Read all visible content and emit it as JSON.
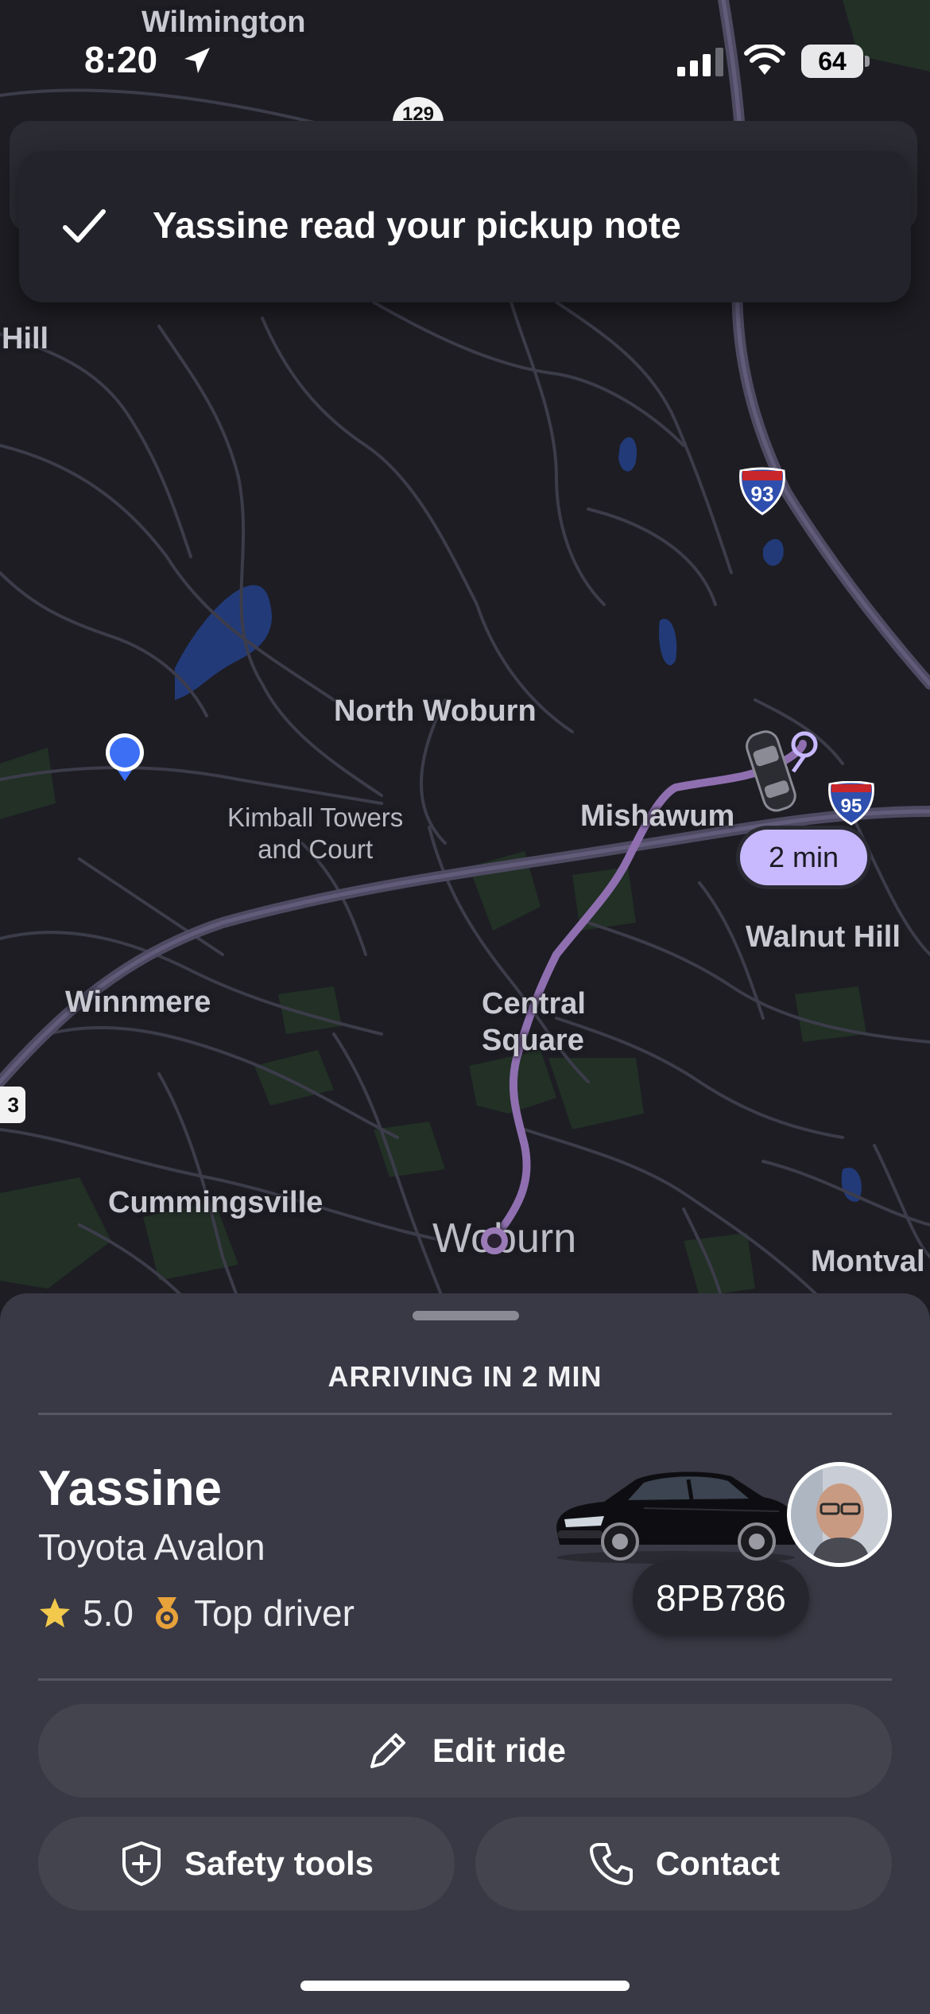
{
  "status_bar": {
    "time": "8:20",
    "battery": "64"
  },
  "toast": {
    "message": "Yassine read your pickup note",
    "icon": "checkmark-icon"
  },
  "map": {
    "labels": {
      "wilmington": "Wilmington",
      "hill": "Hill",
      "north_woburn": "North Woburn",
      "kimball_line1": "Kimball Towers",
      "kimball_line2": "and Court",
      "mishawum": "Mishawum",
      "walnut_hill": "Walnut Hill",
      "winnmere": "Winnmere",
      "central_line1": "Central",
      "central_line2": "Square",
      "cummingsville": "Cummingsville",
      "woburn": "Woburn",
      "montvale": "Montval"
    },
    "shields": {
      "route_129": "129",
      "i93": "93",
      "i95": "95",
      "us3": "3"
    },
    "eta_pill": "2 min"
  },
  "ride": {
    "arriving_text": "ARRIVING IN 2 MIN",
    "driver_name": "Yassine",
    "car_model": "Toyota Avalon",
    "rating": "5.0",
    "badge": "Top driver",
    "plate": "8PB786"
  },
  "actions": {
    "edit_ride": "Edit ride",
    "safety_tools": "Safety tools",
    "contact": "Contact"
  },
  "colors": {
    "map_bg": "#1d1d23",
    "road": "#3c3c4a",
    "highway": "#5a5670",
    "route": "#9b7ab8",
    "eta_pill": "#c8b9ff",
    "sheet_bg": "#393945",
    "button_bg": "#44444f",
    "user_dot": "#3d6ff5"
  }
}
